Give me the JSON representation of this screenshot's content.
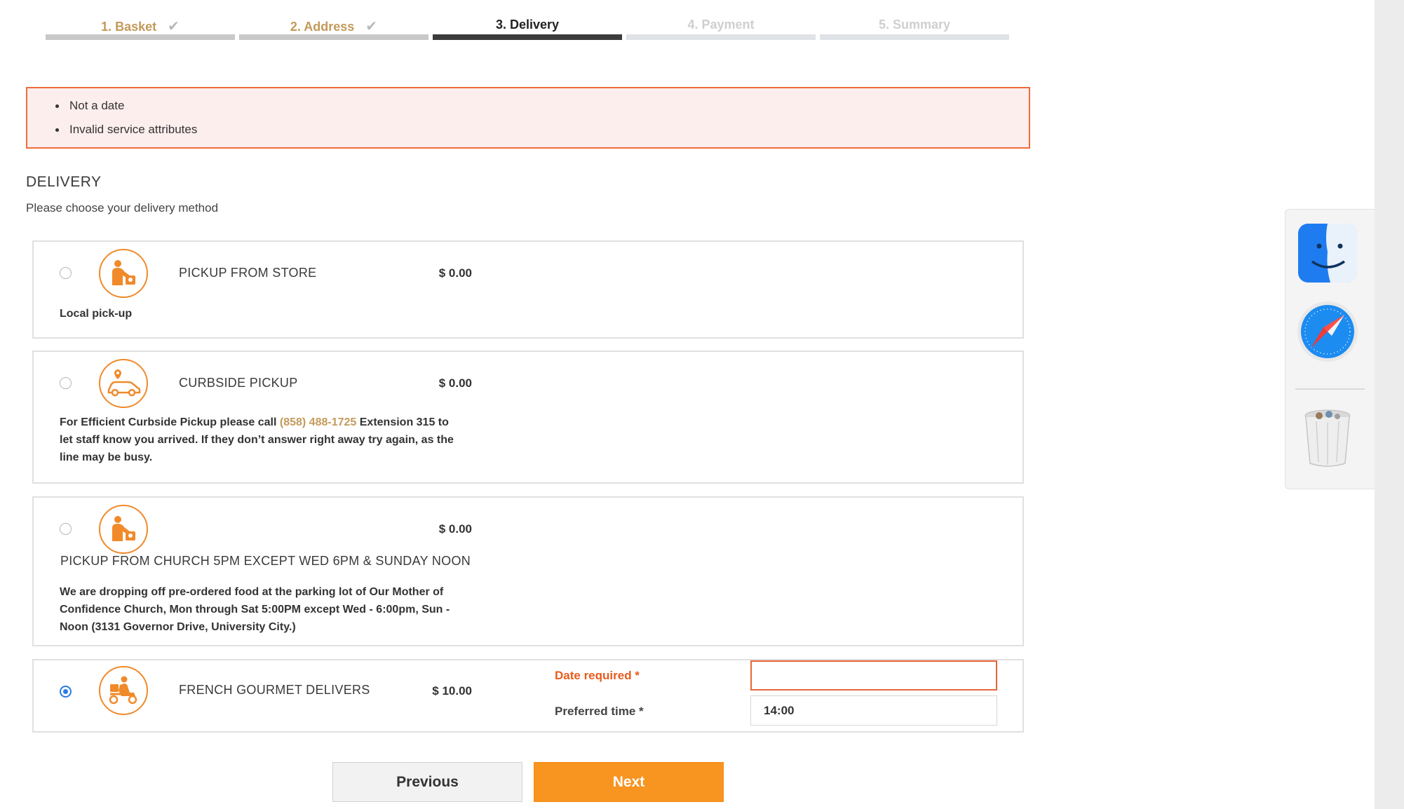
{
  "stepper": {
    "steps": [
      {
        "label": "1. Basket",
        "state": "done",
        "check": "✔"
      },
      {
        "label": "2. Address",
        "state": "done",
        "check": "✔"
      },
      {
        "label": "3. Delivery",
        "state": "active"
      },
      {
        "label": "4. Payment",
        "state": "todo"
      },
      {
        "label": "5. Summary",
        "state": "todo"
      }
    ]
  },
  "errors": [
    "Not a date",
    "Invalid service attributes"
  ],
  "section": {
    "title": "DELIVERY",
    "subtitle": "Please choose your delivery method"
  },
  "options": [
    {
      "name": "PICKUP FROM STORE",
      "price": "$ 0.00",
      "desc": "Local pick-up",
      "icon": "store-pickup-icon",
      "selected": false
    },
    {
      "name": "CURBSIDE PICKUP",
      "price": "$ 0.00",
      "desc_pre": "For Efficient Curbside Pickup please call",
      "phone": "(858) 488-1725",
      "desc_post": "Extension 315 to let staff know you arrived.  If they don’t answer right away try again, as the line may be busy.",
      "icon": "curbside-car-icon",
      "selected": false
    },
    {
      "name": "PICKUP FROM CHURCH 5PM EXCEPT WED 6PM & SUNDAY NOON",
      "price": "$ 0.00",
      "desc": "We are dropping off pre-ordered food at the parking lot of Our Mother of Confidence Church, Mon through Sat 5:00PM except Wed - 6:00pm, Sun - Noon  (3131 Governor Drive, University City.)",
      "icon": "store-pickup-icon",
      "selected": false
    },
    {
      "name": "FRENCH GOURMET DELIVERS",
      "price": "$ 10.00",
      "icon": "delivery-scooter-icon",
      "selected": true,
      "date_label": "Date required *",
      "date_value": "",
      "time_label": "Preferred time *",
      "time_value": "14:00"
    }
  ],
  "buttons": {
    "previous": "Previous",
    "next": "Next"
  },
  "dock": {
    "apps": [
      "finder-icon",
      "safari-icon",
      "trash-icon"
    ]
  },
  "colors": {
    "accent_orange": "#f89420",
    "error_border": "#f06b3c",
    "error_bg": "#fdeeee",
    "link_gold": "#c39a5a",
    "radio_blue": "#2b7ae6"
  }
}
